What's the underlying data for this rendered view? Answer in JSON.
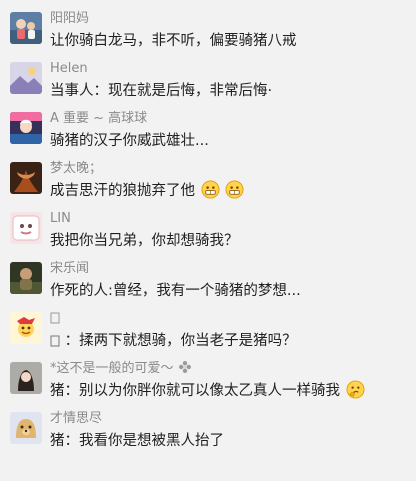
{
  "comments": [
    {
      "name": "阳阳妈",
      "text": "让你骑白龙马，非不听，偏要骑猪八戒"
    },
    {
      "name": "Helen",
      "text": "当事人：现在就是后悔，非常后悔·"
    },
    {
      "name": "A 重要 ~ 高球球",
      "text": "骑猪的汉子你威武雄壮..."
    },
    {
      "name": "梦太晚；",
      "text": "成吉思汗的狼抛弃了他"
    },
    {
      "name": "LIN",
      "text": "我把你当兄弟，你却想骑我？"
    },
    {
      "name": "宋乐闻",
      "text": "作死的人:曾经，我有一个骑猪的梦想..."
    },
    {
      "name": "",
      "text": "：揉两下就想骑，你当老子是猪吗？"
    },
    {
      "name": "*这不是一般的可爱～",
      "text": "猪：别以为你胖你就可以像太乙真人一样骑我"
    },
    {
      "name": "才情思尽",
      "text": "猪：我看你是想被黑人抬了"
    }
  ],
  "icons": {
    "emoji_1": "grimacing-face-icon",
    "emoji_2": "grimacing-face-icon",
    "flower": "flower-icon",
    "thinking": "thinking-face-icon",
    "placeholder": "missing-glyph-box-icon"
  }
}
